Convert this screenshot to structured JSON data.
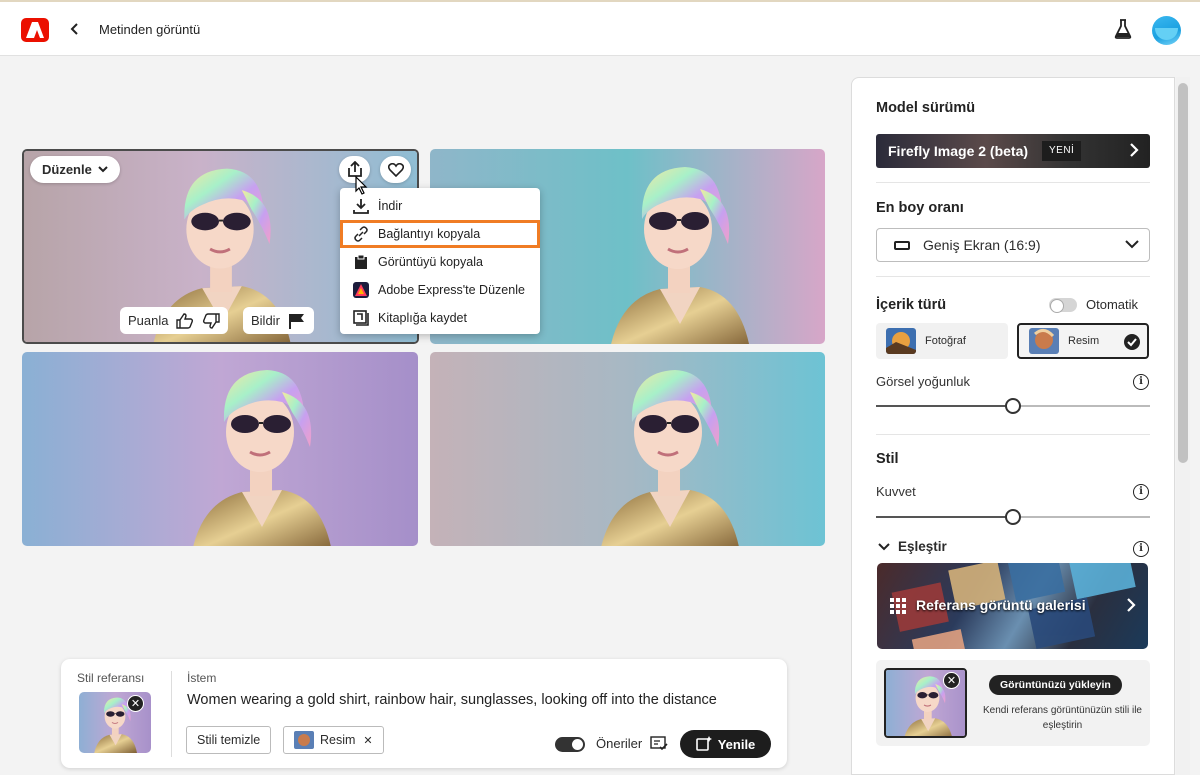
{
  "header": {
    "title": "Metinden görüntü"
  },
  "colors": {
    "brand": "#eb1000",
    "accent_orange": "#f07c24",
    "dark": "#1d1d1d"
  },
  "image_actions": {
    "edit_label": "Düzenle",
    "rate_label": "Puanla",
    "report_label": "Bildir"
  },
  "share_menu": {
    "items": [
      {
        "label": "İndir",
        "icon": "download-icon"
      },
      {
        "label": "Bağlantıyı kopyala",
        "icon": "link-icon",
        "selected": true
      },
      {
        "label": "Görüntüyü kopyala",
        "icon": "clipboard-icon"
      },
      {
        "label": "Adobe Express'te Düzenle",
        "icon": "adobe-express-icon"
      },
      {
        "label": "Kitaplığa kaydet",
        "icon": "library-icon"
      }
    ]
  },
  "panel": {
    "model": {
      "title": "Model sürümü",
      "value": "Firefly Image 2 (beta)",
      "badge": "YENİ"
    },
    "aspect": {
      "title": "En boy oranı",
      "value": "Geniş Ekran (16:9)"
    },
    "content_type": {
      "title": "İçerik türü",
      "auto_label": "Otomatik",
      "auto_enabled": false,
      "options": [
        {
          "label": "Fotoğraf",
          "selected": false
        },
        {
          "label": "Resim",
          "selected": true
        }
      ]
    },
    "visual_intensity": {
      "label": "Görsel yoğunluk",
      "value": 0.5
    },
    "style": {
      "title": "Stil",
      "strength_label": "Kuvvet",
      "strength_value": 0.5,
      "match_label": "Eşleştir",
      "gallery_label": "Referans görüntü galerisi",
      "upload_button": "Görüntünüzü yükleyin",
      "upload_desc": "Kendi referans görüntünüzün stili ile eşleştirin"
    }
  },
  "prompt_bar": {
    "style_ref_label": "Stil referansı",
    "prompt_label": "İstem",
    "prompt_text": "Women wearing a gold shirt, rainbow hair, sunglasses, looking off into the distance",
    "clear_style_label": "Stili temizle",
    "art_chip_label": "Resim",
    "suggestions_label": "Öneriler",
    "suggestions_enabled": true,
    "generate_label": "Yenile"
  }
}
